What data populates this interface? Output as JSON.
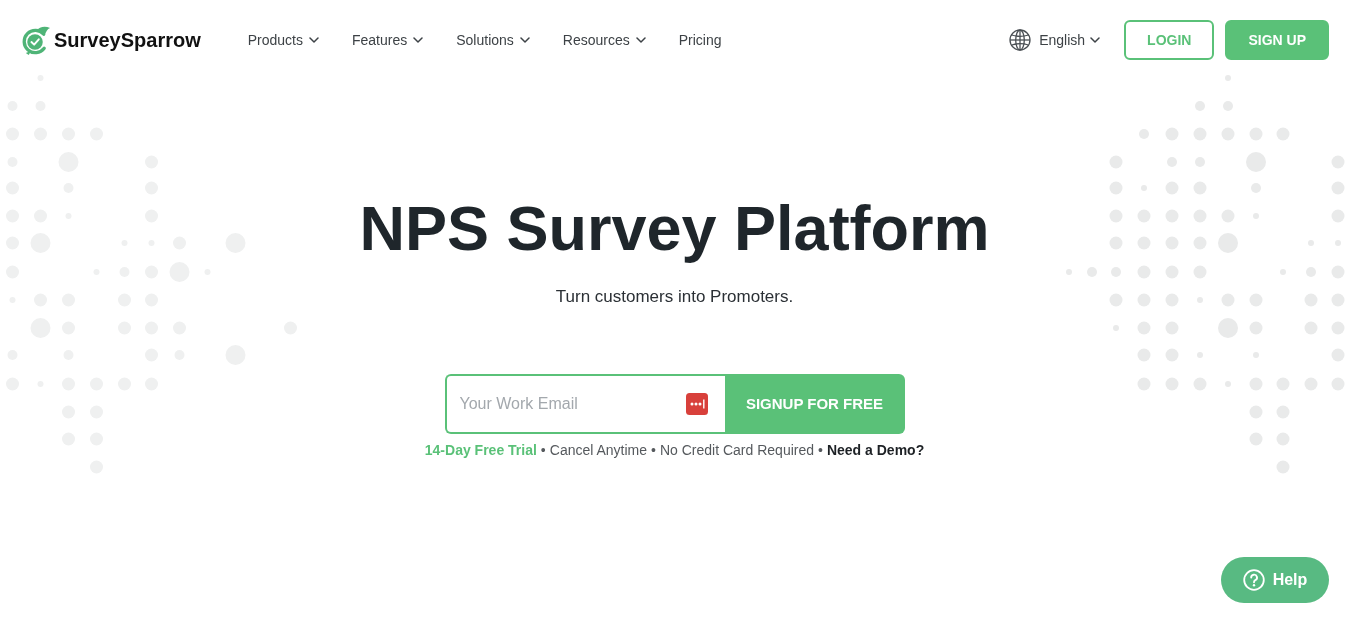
{
  "header": {
    "logo": {
      "text": "SurveySparrow"
    },
    "nav": [
      {
        "label": "Products",
        "has_menu": true
      },
      {
        "label": "Features",
        "has_menu": true
      },
      {
        "label": "Solutions",
        "has_menu": true
      },
      {
        "label": "Resources",
        "has_menu": true
      },
      {
        "label": "Pricing",
        "has_menu": false
      }
    ],
    "language": {
      "label": "English"
    },
    "buttons": [
      {
        "label": "LOGIN",
        "kind": "outline"
      },
      {
        "label": "SIGN UP",
        "kind": "filled"
      }
    ]
  },
  "hero": {
    "title": "NPS Survey Platform",
    "subtitle": "Turn customers into Promoters.",
    "signup_form": {
      "placeholder": "Your Work Email",
      "button": "SIGNUP FOR FREE"
    },
    "trial_note": [
      {
        "text": "14-Day Free Trial",
        "kind": "highlight"
      },
      {
        "text": "•",
        "kind": "separator"
      },
      {
        "text": "Cancel Anytime",
        "kind": "plain"
      },
      {
        "text": "•",
        "kind": "separator"
      },
      {
        "text": "No Credit Card Required",
        "kind": "plain"
      },
      {
        "text": "•",
        "kind": "separator"
      },
      {
        "text": "Need a Demo?",
        "kind": "link"
      }
    ]
  },
  "help_button": {
    "label": "Help"
  }
}
